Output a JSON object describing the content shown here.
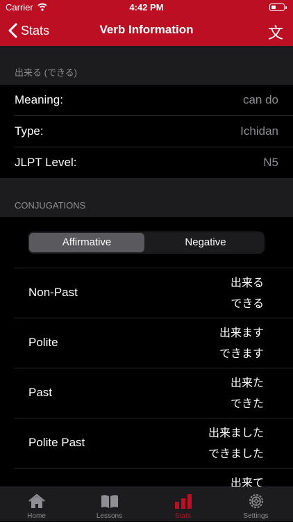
{
  "status": {
    "carrier": "Carrier",
    "time": "4:42 PM"
  },
  "nav": {
    "back_label": "Stats",
    "title": "Verb Information",
    "kanji_button": "文"
  },
  "verb": {
    "header": "出来る (できる)",
    "details": [
      {
        "key": "Meaning:",
        "value": "can do"
      },
      {
        "key": "Type:",
        "value": "Ichidan"
      },
      {
        "key": "JLPT Level:",
        "value": "N5"
      }
    ]
  },
  "conjugations": {
    "header": "CONJUGATIONS",
    "segments": {
      "selected": "Affirmative",
      "other": "Negative"
    },
    "rows": [
      {
        "form": "Non-Past",
        "kanji": "出来る",
        "kana": "できる"
      },
      {
        "form": "Polite",
        "kanji": "出来ます",
        "kana": "できます"
      },
      {
        "form": "Past",
        "kanji": "出来た",
        "kana": "できた"
      },
      {
        "form": "Polite Past",
        "kanji": "出来ました",
        "kana": "できました"
      },
      {
        "form": "",
        "kanji": "出来て",
        "kana": ""
      }
    ]
  },
  "tabs": [
    {
      "label": "Home",
      "icon": "home-icon"
    },
    {
      "label": "Lessons",
      "icon": "book-icon"
    },
    {
      "label": "Stats",
      "icon": "bar-chart-icon",
      "active": true
    },
    {
      "label": "Settings",
      "icon": "gear-icon"
    }
  ],
  "colors": {
    "accent": "#bc0f24",
    "background": "#000000",
    "group": "#1c1c1e",
    "secondary": "#8e8e93"
  }
}
